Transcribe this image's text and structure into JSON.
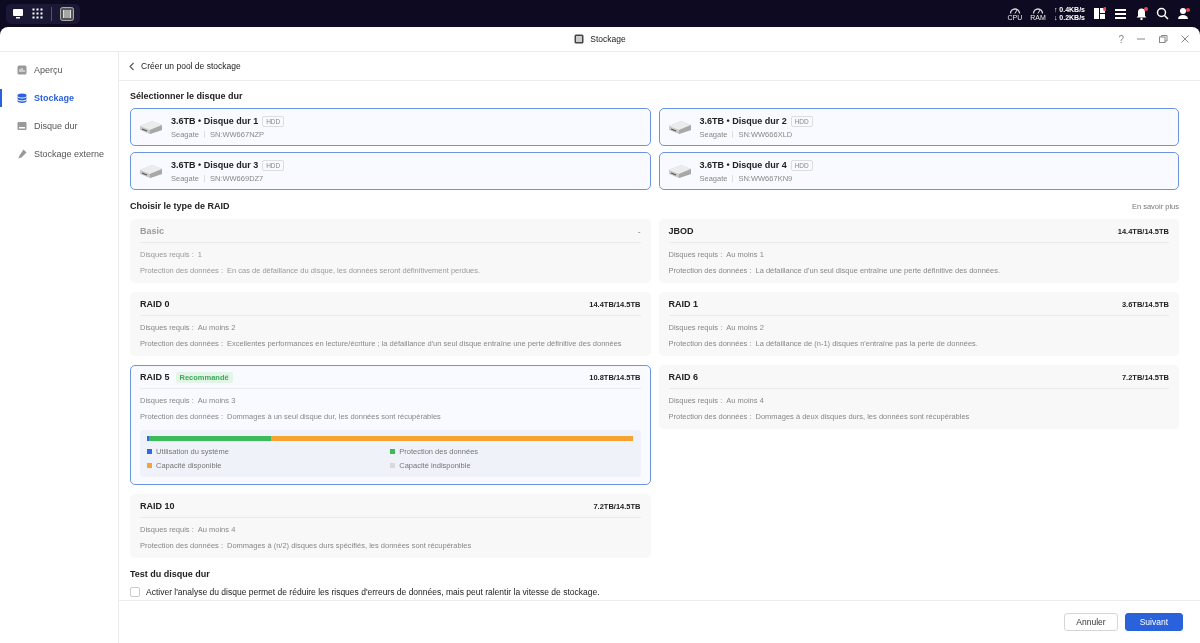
{
  "taskbar": {
    "cpu_label": "CPU",
    "ram_label": "RAM",
    "upload": "↑ 0.4KB/s",
    "download": "↓ 0.2KB/s"
  },
  "window": {
    "title": "Stockage",
    "help": "?"
  },
  "sidebar": {
    "items": [
      {
        "label": "Aperçu",
        "selected": false
      },
      {
        "label": "Stockage",
        "selected": true
      },
      {
        "label": "Disque dur",
        "selected": false
      },
      {
        "label": "Stockage externe",
        "selected": false
      }
    ]
  },
  "page": {
    "title": "Créer un pool de stockage"
  },
  "disks": {
    "heading": "Sélectionner le disque dur",
    "items": [
      {
        "title": "3.6TB • Disque dur 1",
        "type": "HDD",
        "vendor": "Seagate",
        "serial": "SN:WW667NZP",
        "selected": true
      },
      {
        "title": "3.6TB • Disque dur 2",
        "type": "HDD",
        "vendor": "Seagate",
        "serial": "SN:WW666XLD",
        "selected": true
      },
      {
        "title": "3.6TB • Disque dur 3",
        "type": "HDD",
        "vendor": "Seagate",
        "serial": "SN:WW669DZ7",
        "selected": true
      },
      {
        "title": "3.6TB • Disque dur 4",
        "type": "HDD",
        "vendor": "Seagate",
        "serial": "SN:WW667KN9",
        "selected": true
      }
    ]
  },
  "raid": {
    "heading": "Choisir le type de RAID",
    "learn_more": "En savoir plus",
    "types": [
      {
        "name": "Basic",
        "capacity": "-",
        "required_label": "Disques requis :",
        "required": "1",
        "protection_label": "Protection des données :",
        "protection": "En cas de défaillance du disque, les données seront définitivement perdues.",
        "disabled": true,
        "selected": false
      },
      {
        "name": "JBOD",
        "capacity": "14.4TB/14.5TB",
        "required_label": "Disques requis :",
        "required": "Au moins 1",
        "protection_label": "Protection des données :",
        "protection": "La défaillance d'un seul disque entraîne une perte définitive des données.",
        "disabled": false,
        "selected": false
      },
      {
        "name": "RAID 0",
        "capacity": "14.4TB/14.5TB",
        "required_label": "Disques requis :",
        "required": "Au moins 2",
        "protection_label": "Protection des données :",
        "protection": "Excellentes performances en lecture/écriture ; la défaillance d'un seul disque entraîne une perte définitive des données",
        "disabled": false,
        "selected": false
      },
      {
        "name": "RAID 1",
        "capacity": "3.6TB/14.5TB",
        "required_label": "Disques requis :",
        "required": "Au moins 2",
        "protection_label": "Protection des données :",
        "protection": "La défaillance de (n-1) disques n'entraîne pas la perte de données.",
        "disabled": false,
        "selected": false
      },
      {
        "name": "RAID 5",
        "badge": "Recommandé",
        "capacity": "10.8TB/14.5TB",
        "required_label": "Disques requis :",
        "required": "Au moins 3",
        "protection_label": "Protection des données :",
        "protection": "Dommages à un seul disque dur, les données sont récupérables",
        "disabled": false,
        "selected": true,
        "usage": [
          {
            "label": "Utilisation du système",
            "color": "#2f6bdc",
            "level": 0.004
          },
          {
            "label": "Protection des données",
            "color": "#3dba5a",
            "level": 0.25
          },
          {
            "label": "Capacité disponible",
            "color": "#f5a431",
            "level": 0.746
          },
          {
            "label": "Capacité indisponible",
            "color": "#d9d9d9"
          }
        ]
      },
      {
        "name": "RAID 6",
        "capacity": "7.2TB/14.5TB",
        "required_label": "Disques requis :",
        "required": "Au moins 4",
        "protection_label": "Protection des données :",
        "protection": "Dommages à deux disques durs, les données sont récupérables",
        "disabled": false,
        "selected": false
      },
      {
        "name": "RAID 10",
        "capacity": "7.2TB/14.5TB",
        "required_label": "Disques requis :",
        "required": "Au moins 4",
        "protection_label": "Protection des données :",
        "protection": "Dommages à (n/2) disques durs spécifiés, les données sont récupérables",
        "disabled": false,
        "selected": false
      }
    ]
  },
  "test": {
    "heading": "Test du disque dur",
    "checkbox": {
      "label": "Activer l'analyse du disque permet de réduire les risques d'erreurs de données, mais peut ralentir la vitesse de stockage.",
      "checked": false
    }
  },
  "footer": {
    "buttons": [
      {
        "label": "Annuler",
        "kind": "secondary"
      },
      {
        "label": "Suivant",
        "kind": "primary"
      }
    ]
  }
}
